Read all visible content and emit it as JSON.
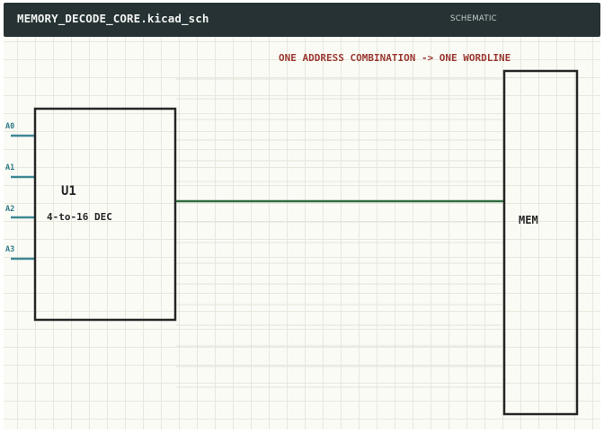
{
  "header": {
    "filename": "MEMORY_DECODE_CORE.kicad_sch",
    "mode": "SCHEMATIC"
  },
  "annotation": {
    "text": "ONE ADDRESS COMBINATION -> ONE WORDLINE"
  },
  "decoder": {
    "ref": "U1",
    "value": "4-to-16 DEC",
    "pins": [
      {
        "label": "A0"
      },
      {
        "label": "A1"
      },
      {
        "label": "A2"
      },
      {
        "label": "A3"
      }
    ]
  },
  "memory": {
    "label": "MEM"
  },
  "colors": {
    "header_bg": "#263233",
    "grid": "#e6e8dc",
    "canvas_bg": "#fbfbf6",
    "component_outline": "#262626",
    "pin_wire": "#3f8794",
    "pin_label": "#2f7a88",
    "wordline": "#2f6b3f",
    "annotation": "#9b3a32"
  }
}
